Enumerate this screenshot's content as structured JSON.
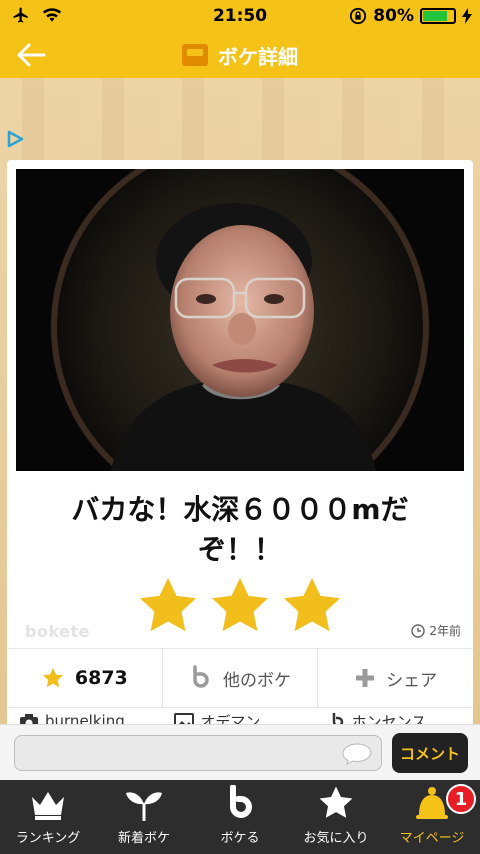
{
  "status_bar": {
    "time": "21:50",
    "battery_percent": "80%",
    "battery_level": 0.8
  },
  "header": {
    "title": "ボケ詳細"
  },
  "post": {
    "caption": "バカな！水深６０００mだぞ！！",
    "rating_stars": 3,
    "watermark": "bokete",
    "posted_ago": "2年前"
  },
  "actions": {
    "star_count": "6873",
    "other_boke_label": "他のボケ",
    "share_label": "シェア"
  },
  "meta": {
    "photographer": "burnelking",
    "topic": "オデマン",
    "user": "ホンセンス"
  },
  "comment": {
    "button_label": "コメント"
  },
  "tabs": [
    {
      "label": "ランキング",
      "icon": "crown-icon"
    },
    {
      "label": "新着ボケ",
      "icon": "sprout-icon"
    },
    {
      "label": "ボケる",
      "icon": "boke-logo-icon"
    },
    {
      "label": "お気に入り",
      "icon": "star-icon"
    },
    {
      "label": "マイページ",
      "icon": "bell-icon"
    }
  ],
  "notification_count": "1",
  "colors": {
    "brand_yellow": "#f5c217",
    "dark": "#2d2d2d",
    "star": "#f2be1b",
    "badge": "#e81e26"
  }
}
